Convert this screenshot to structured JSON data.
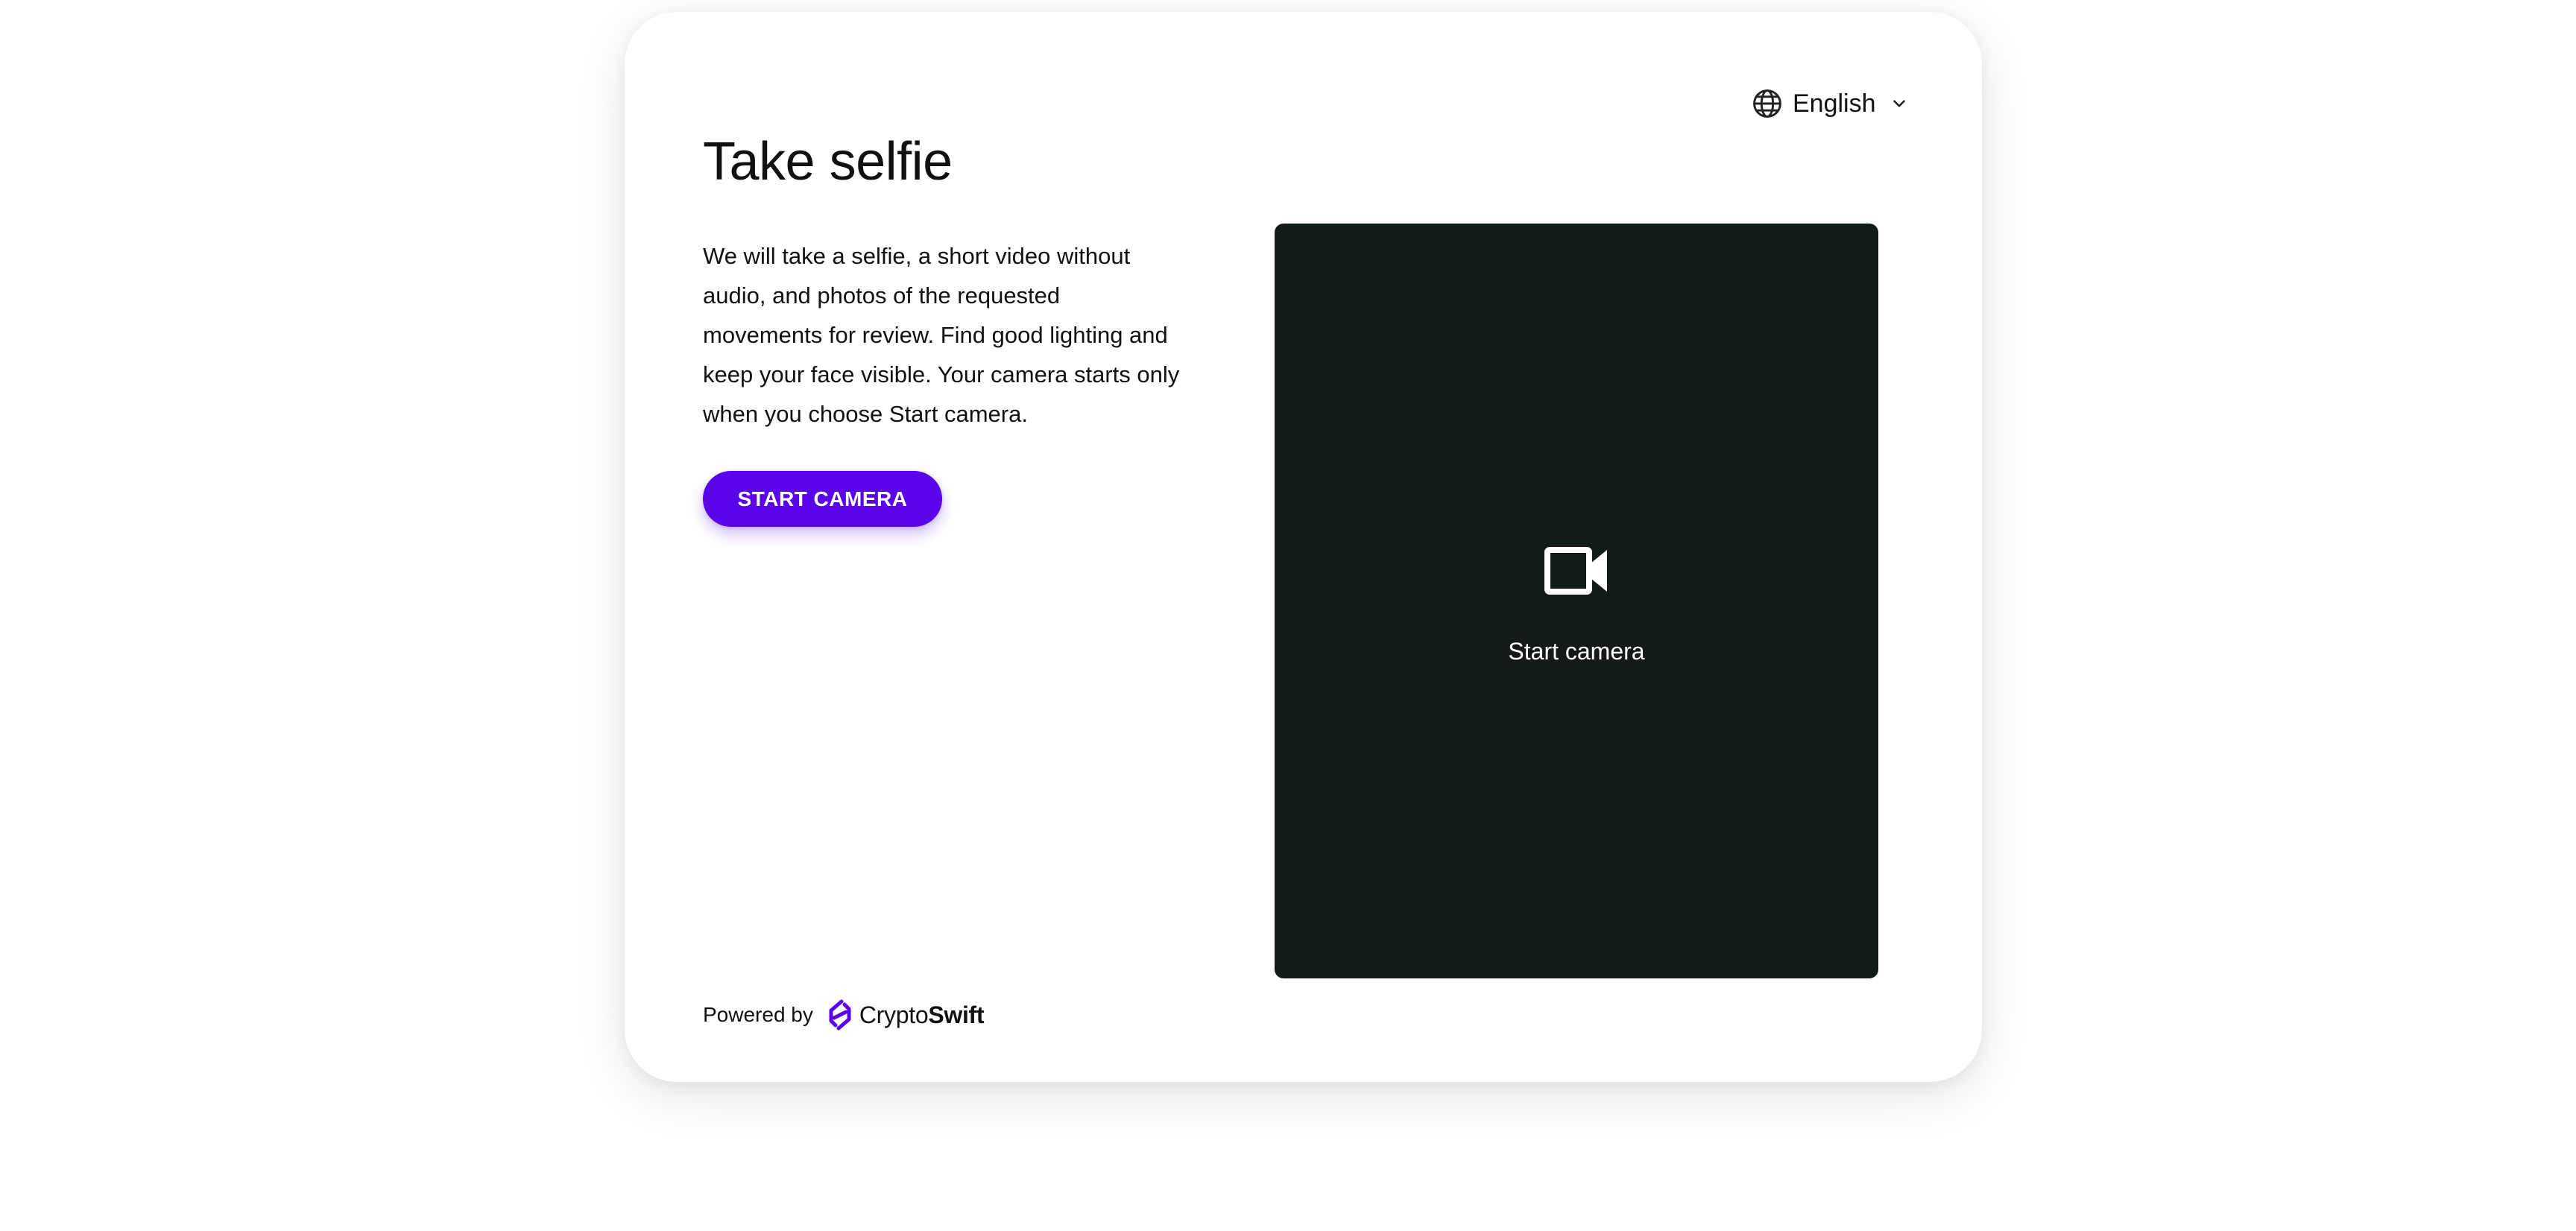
{
  "language": {
    "selected": "English"
  },
  "page": {
    "title": "Take selfie",
    "description": "We will take a selfie, a short video without audio, and photos of the requested movements for review. Find good lighting and keep your face visible. Your camera starts only when you choose Start camera.",
    "start_button": "START CAMERA"
  },
  "camera_preview": {
    "label": "Start camera",
    "icon": "video-camera-icon"
  },
  "footer": {
    "powered_by": "Powered by",
    "brand_regular": "Crypto",
    "brand_bold": "Swift",
    "logo_icon": "cryptoswift-logo"
  },
  "colors": {
    "accent": "#5a04ea",
    "preview_background": "#131b19",
    "text": "#111111"
  }
}
